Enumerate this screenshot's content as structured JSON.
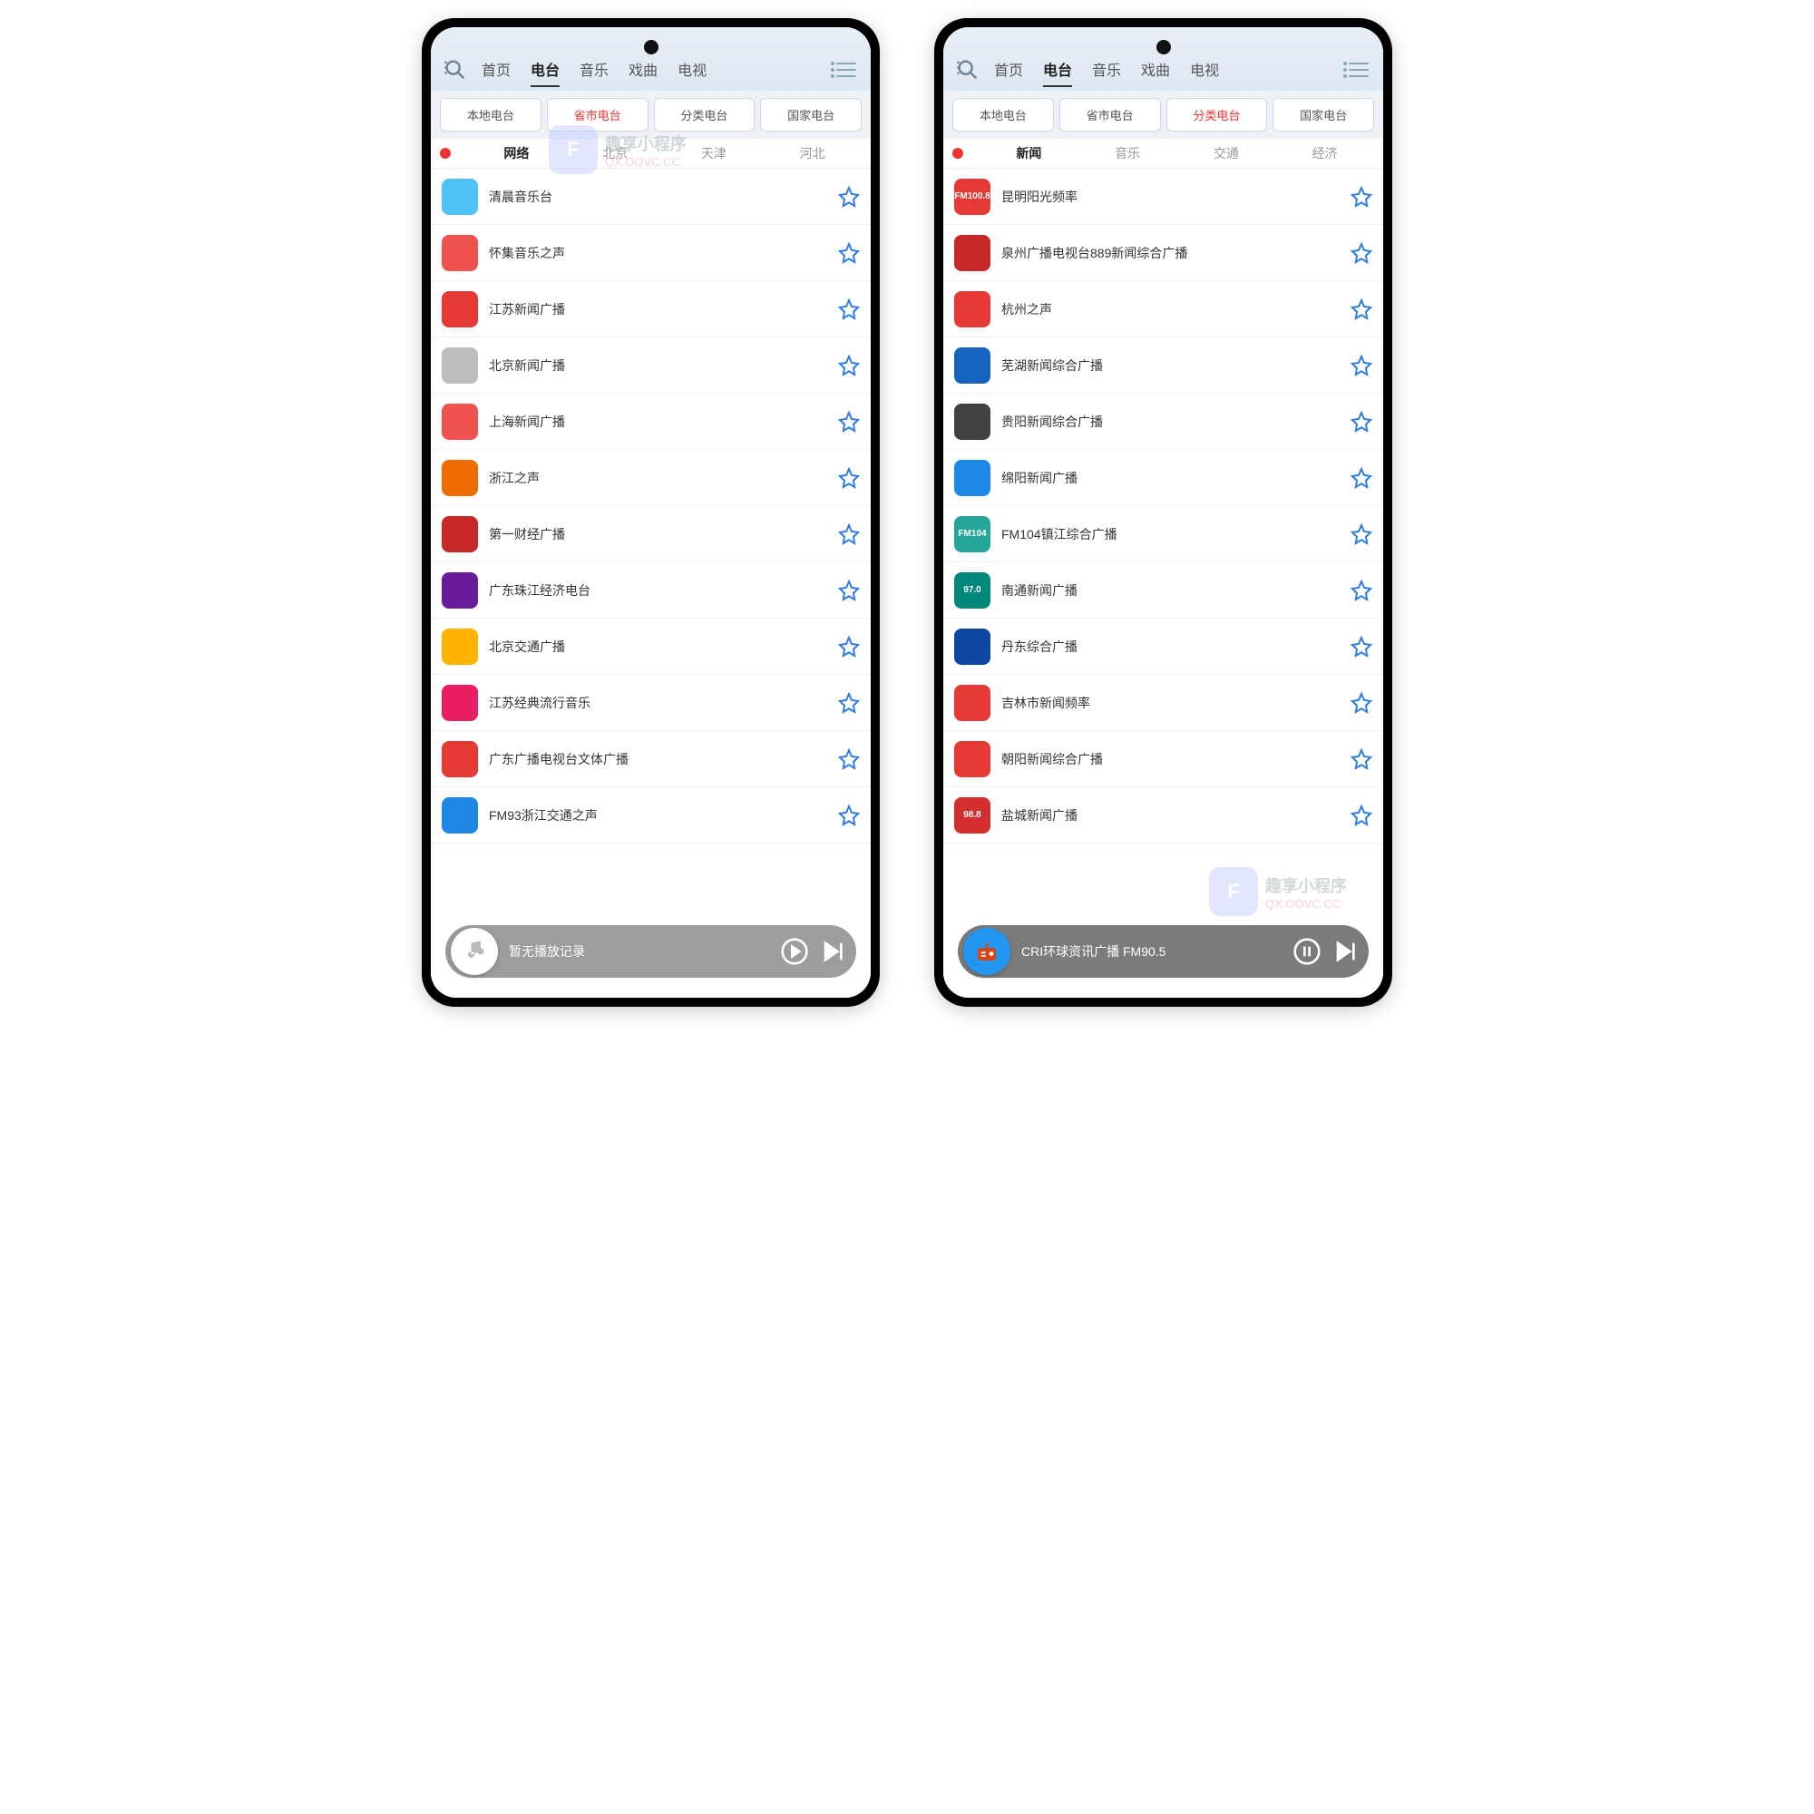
{
  "mainTabs": [
    "首页",
    "电台",
    "音乐",
    "戏曲",
    "电视"
  ],
  "mainActiveIndex": 1,
  "subTabs": [
    "本地电台",
    "省市电台",
    "分类电台",
    "国家电台"
  ],
  "left": {
    "subActive": 1,
    "cats": [
      "网络",
      "北京",
      "天津",
      "河北"
    ],
    "catActive": 0,
    "stations": [
      {
        "name": "清晨音乐台",
        "bg": "#4fc3f7"
      },
      {
        "name": "怀集音乐之声",
        "bg": "#ef5350"
      },
      {
        "name": "江苏新闻广播",
        "bg": "#e53935"
      },
      {
        "name": "北京新闻广播",
        "bg": "#bdbdbd"
      },
      {
        "name": "上海新闻广播",
        "bg": "#ef5350"
      },
      {
        "name": "浙江之声",
        "bg": "#ef6c00"
      },
      {
        "name": "第一财经广播",
        "bg": "#c62828"
      },
      {
        "name": "广东珠江经济电台",
        "bg": "#6a1b9a"
      },
      {
        "name": "北京交通广播",
        "bg": "#ffb300"
      },
      {
        "name": "江苏经典流行音乐",
        "bg": "#e91e63"
      },
      {
        "name": "广东广播电视台文体广播",
        "bg": "#e53935"
      },
      {
        "name": "FM93浙江交通之声",
        "bg": "#1e88e5"
      }
    ],
    "player": {
      "text": "暂无播放记录"
    }
  },
  "right": {
    "subActive": 2,
    "cats": [
      "新闻",
      "音乐",
      "交通",
      "经济"
    ],
    "catActive": 0,
    "stations": [
      {
        "name": "昆明阳光频率",
        "bg": "#e53935",
        "tag": "FM100.8"
      },
      {
        "name": "泉州广播电视台889新闻综合广播",
        "bg": "#c62828"
      },
      {
        "name": "杭州之声",
        "bg": "#e53935"
      },
      {
        "name": "芜湖新闻综合广播",
        "bg": "#1565c0"
      },
      {
        "name": "贵阳新闻综合广播",
        "bg": "#424242"
      },
      {
        "name": "绵阳新闻广播",
        "bg": "#1e88e5"
      },
      {
        "name": "FM104镇江综合广播",
        "bg": "#26a69a",
        "tag": "FM104"
      },
      {
        "name": "南通新闻广播",
        "bg": "#00897b",
        "tag": "97.0"
      },
      {
        "name": "丹东综合广播",
        "bg": "#0d47a1"
      },
      {
        "name": "吉林市新闻频率",
        "bg": "#e53935"
      },
      {
        "name": "朝阳新闻综合广播",
        "bg": "#e53935"
      },
      {
        "name": "盐城新闻广播",
        "bg": "#d32f2f",
        "tag": "98.8"
      }
    ],
    "player": {
      "text": "CRI环球资讯广播 FM90.5"
    }
  },
  "watermark": {
    "brand": "F",
    "title": "趣享小程序",
    "url": "QX.OOVC.CC"
  }
}
